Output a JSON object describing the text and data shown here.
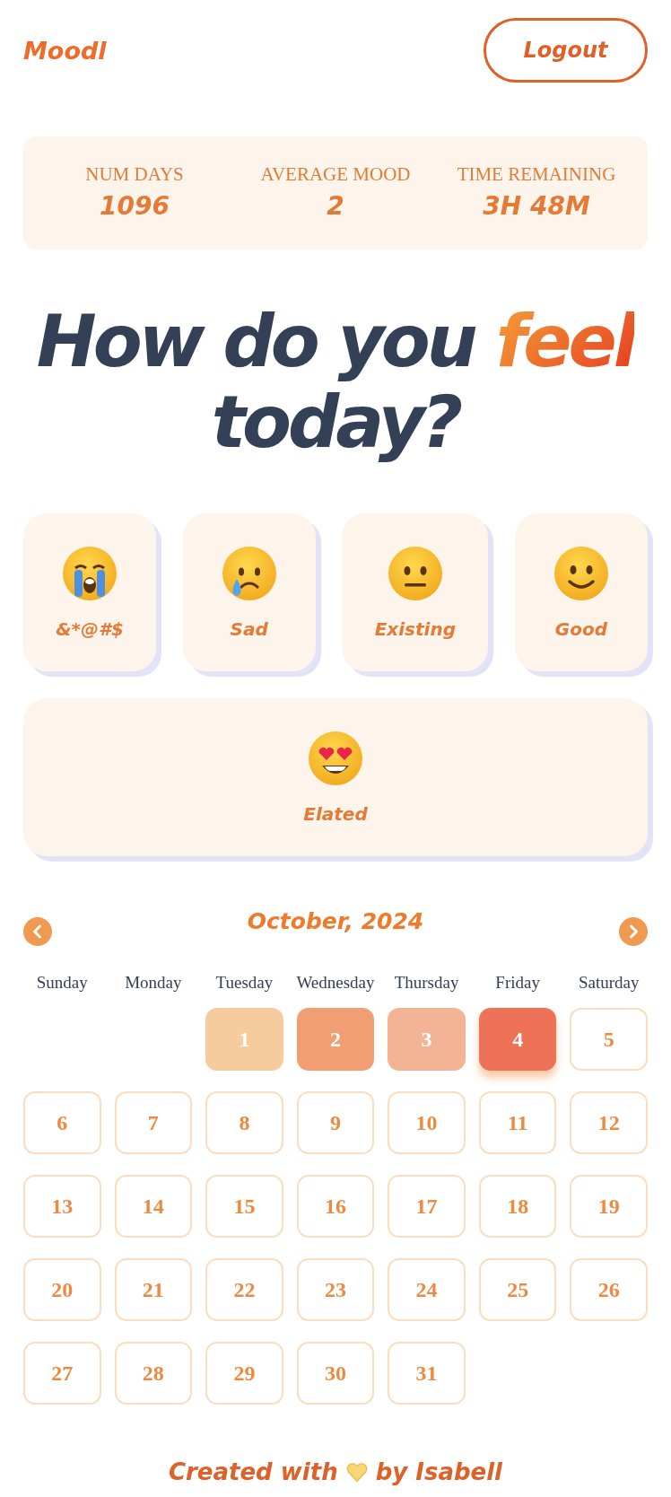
{
  "header": {
    "logo": "Moodl",
    "logout_button": "Logout"
  },
  "stats": [
    {
      "label": "NUM DAYS",
      "value": "1096"
    },
    {
      "label": "AVERAGE MOOD",
      "value": "2"
    },
    {
      "label": "TIME REMAINING",
      "value": "3H 48M"
    }
  ],
  "headline": {
    "before": "How do you",
    "highlight": "feel",
    "after": "today?"
  },
  "moods": [
    {
      "kind": "crying",
      "label": "&*@#$"
    },
    {
      "kind": "sad",
      "label": "Sad"
    },
    {
      "kind": "neutral",
      "label": "Existing"
    },
    {
      "kind": "smile",
      "label": "Good"
    },
    {
      "kind": "hearts",
      "label": "Elated"
    }
  ],
  "calendar": {
    "month": "October, 2024",
    "weekdays": [
      "Sunday",
      "Monday",
      "Tuesday",
      "Wednesday",
      "Thursday",
      "Friday",
      "Saturday"
    ],
    "days": [
      {
        "day": "1",
        "color": "#f6cb9d",
        "today": false
      },
      {
        "day": "2",
        "color": "#f09e72",
        "today": false
      },
      {
        "day": "3",
        "color": "#f3b495",
        "today": false
      },
      {
        "day": "4",
        "color": "#ee7258",
        "today": true
      },
      {
        "day": "5",
        "today": false
      },
      {
        "day": "6",
        "today": false
      },
      {
        "day": "7",
        "today": false
      },
      {
        "day": "8",
        "today": false
      },
      {
        "day": "9",
        "today": false
      },
      {
        "day": "10",
        "today": false
      },
      {
        "day": "11",
        "today": false
      },
      {
        "day": "12",
        "today": false
      },
      {
        "day": "13",
        "today": false
      },
      {
        "day": "14",
        "today": false
      },
      {
        "day": "15",
        "today": false
      },
      {
        "day": "16",
        "today": false
      },
      {
        "day": "17",
        "today": false
      },
      {
        "day": "18",
        "today": false
      },
      {
        "day": "19",
        "today": false
      },
      {
        "day": "20",
        "today": false
      },
      {
        "day": "21",
        "today": false
      },
      {
        "day": "22",
        "today": false
      },
      {
        "day": "23",
        "today": false
      },
      {
        "day": "24",
        "today": false
      },
      {
        "day": "25",
        "today": false
      },
      {
        "day": "26",
        "today": false
      },
      {
        "day": "27",
        "today": false
      },
      {
        "day": "28",
        "today": false
      },
      {
        "day": "29",
        "today": false
      },
      {
        "day": "30",
        "today": false
      },
      {
        "day": "31",
        "today": false
      }
    ]
  },
  "footer": {
    "before": "Created with",
    "after": "by Isabell"
  }
}
